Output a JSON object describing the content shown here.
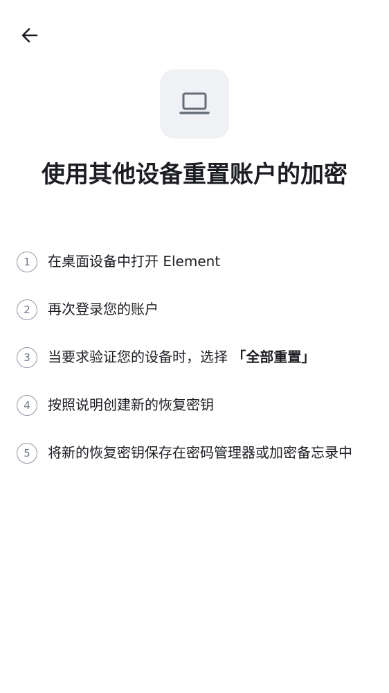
{
  "header": {
    "back_icon": "arrow-left-icon"
  },
  "hero": {
    "icon": "laptop-icon"
  },
  "title": "使用其他设备重置账户的加密",
  "steps": [
    {
      "number": "1",
      "text": "在桌面设备中打开 Element"
    },
    {
      "number": "2",
      "text": "再次登录您的账户"
    },
    {
      "number": "3",
      "text_before": "当要求验证您的设备时，选择 ",
      "text_bold": "「全部重置」"
    },
    {
      "number": "4",
      "text": "按照说明创建新的恢复密钥"
    },
    {
      "number": "5",
      "text": "将新的恢复密钥保存在密码管理器或加密备忘录中"
    }
  ],
  "colors": {
    "icon_box_bg": "#eff1f5",
    "icon": "#656d77",
    "number_ring": "#8d97a5",
    "text": "#1b1d22"
  }
}
